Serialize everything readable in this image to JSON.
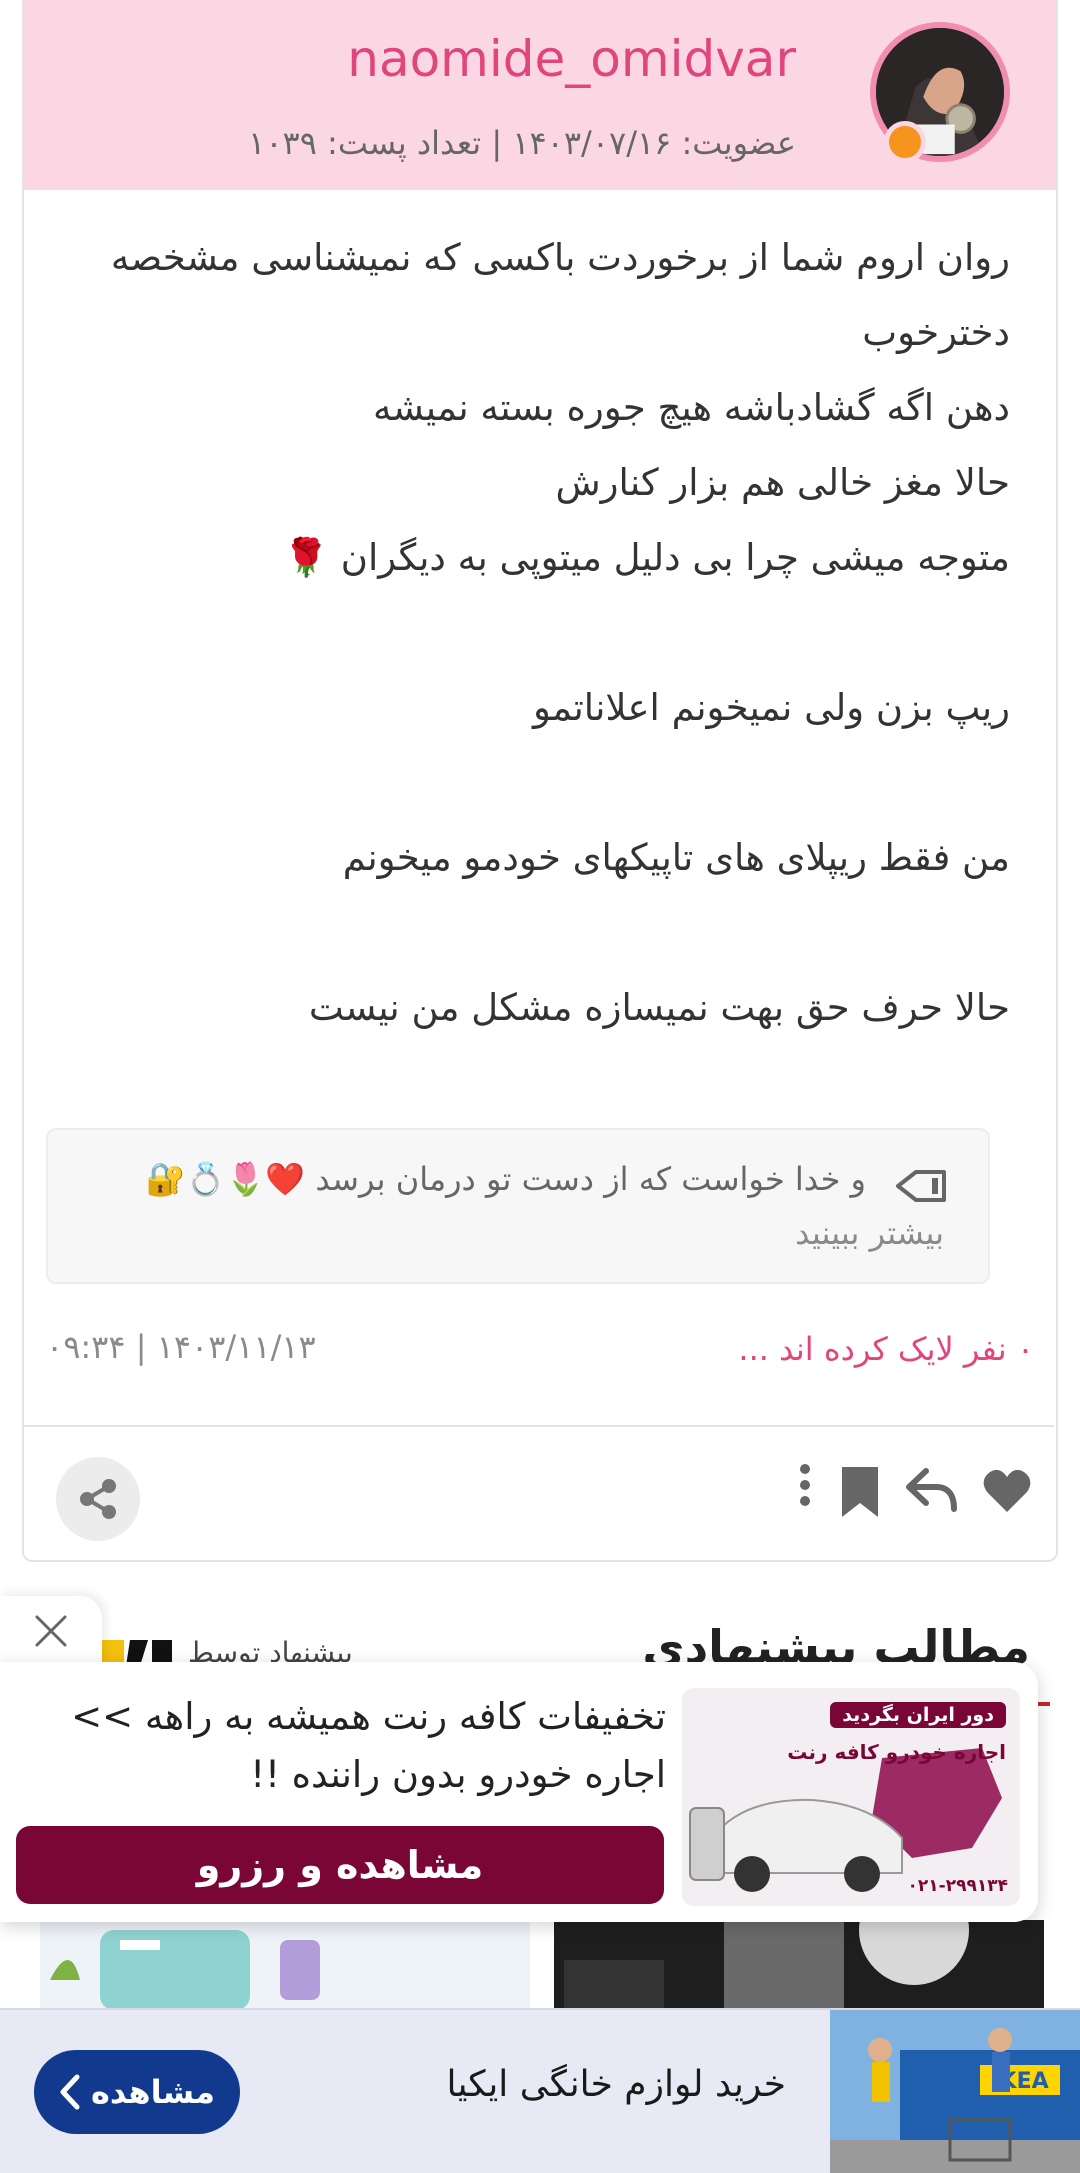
{
  "post": {
    "username": "naomide_omidvar",
    "meta": "عضویت: ۱۴۰۳/۰۷/۱۶ | تعداد پست: ۱۰۳۹",
    "body_lines": [
      "روان اروم شما از برخوردت باکسی که نمیشناسی مشخصه",
      "دخترخوب",
      "دهن اگه گشادباشه هیچ جوره بسته نمیشه",
      "حالا مغز خالی هم بزار کنارش",
      "متوجه میشی چرا بی دلیل میتوپی به دیگران 🌹",
      "",
      "ریپ بزن ولی نمیخونم اعلاناتمو",
      "",
      "من فقط ریپلای های تاپیکهای خودمو میخونم",
      "",
      "حالا حرف حق بهت نمیسازه مشکل من نیست"
    ],
    "quote_preview": "و خدا خواست که از دست تو درمان برسد ❤️🌷💍🔐",
    "see_more": "بیشتر ببینید",
    "likes": "۰ نفر لایک کرده اند ...",
    "datetime": "۰۹:۳۴ | ۱۴۰۳/۱۱/۱۳",
    "icons": [
      "heart-icon",
      "reply-icon",
      "bookmark-icon",
      "more-vertical-icon",
      "share-icon"
    ]
  },
  "suggested": {
    "title": "مطالب پیشنهادی",
    "by": "پیشنهاد توسط"
  },
  "ad_popup": {
    "text": "تخفیفات کافه رنت همیشه به راهه >> اجاره خودرو بدون راننده !!",
    "button": "مشاهده و رزرو",
    "image_title": "دور ایران بگردید",
    "image_subtitle": "اجاره خودرو کافه رنت",
    "image_phone": "۰۲۱-۲۹۹۱۳۴",
    "accent_color": "#7a0636"
  },
  "bottom_banner": {
    "text": "خرید لوازم خانگی ایکیا",
    "button": "مشاهده",
    "brand": "IKEA",
    "accent_color": "#113a8f"
  }
}
